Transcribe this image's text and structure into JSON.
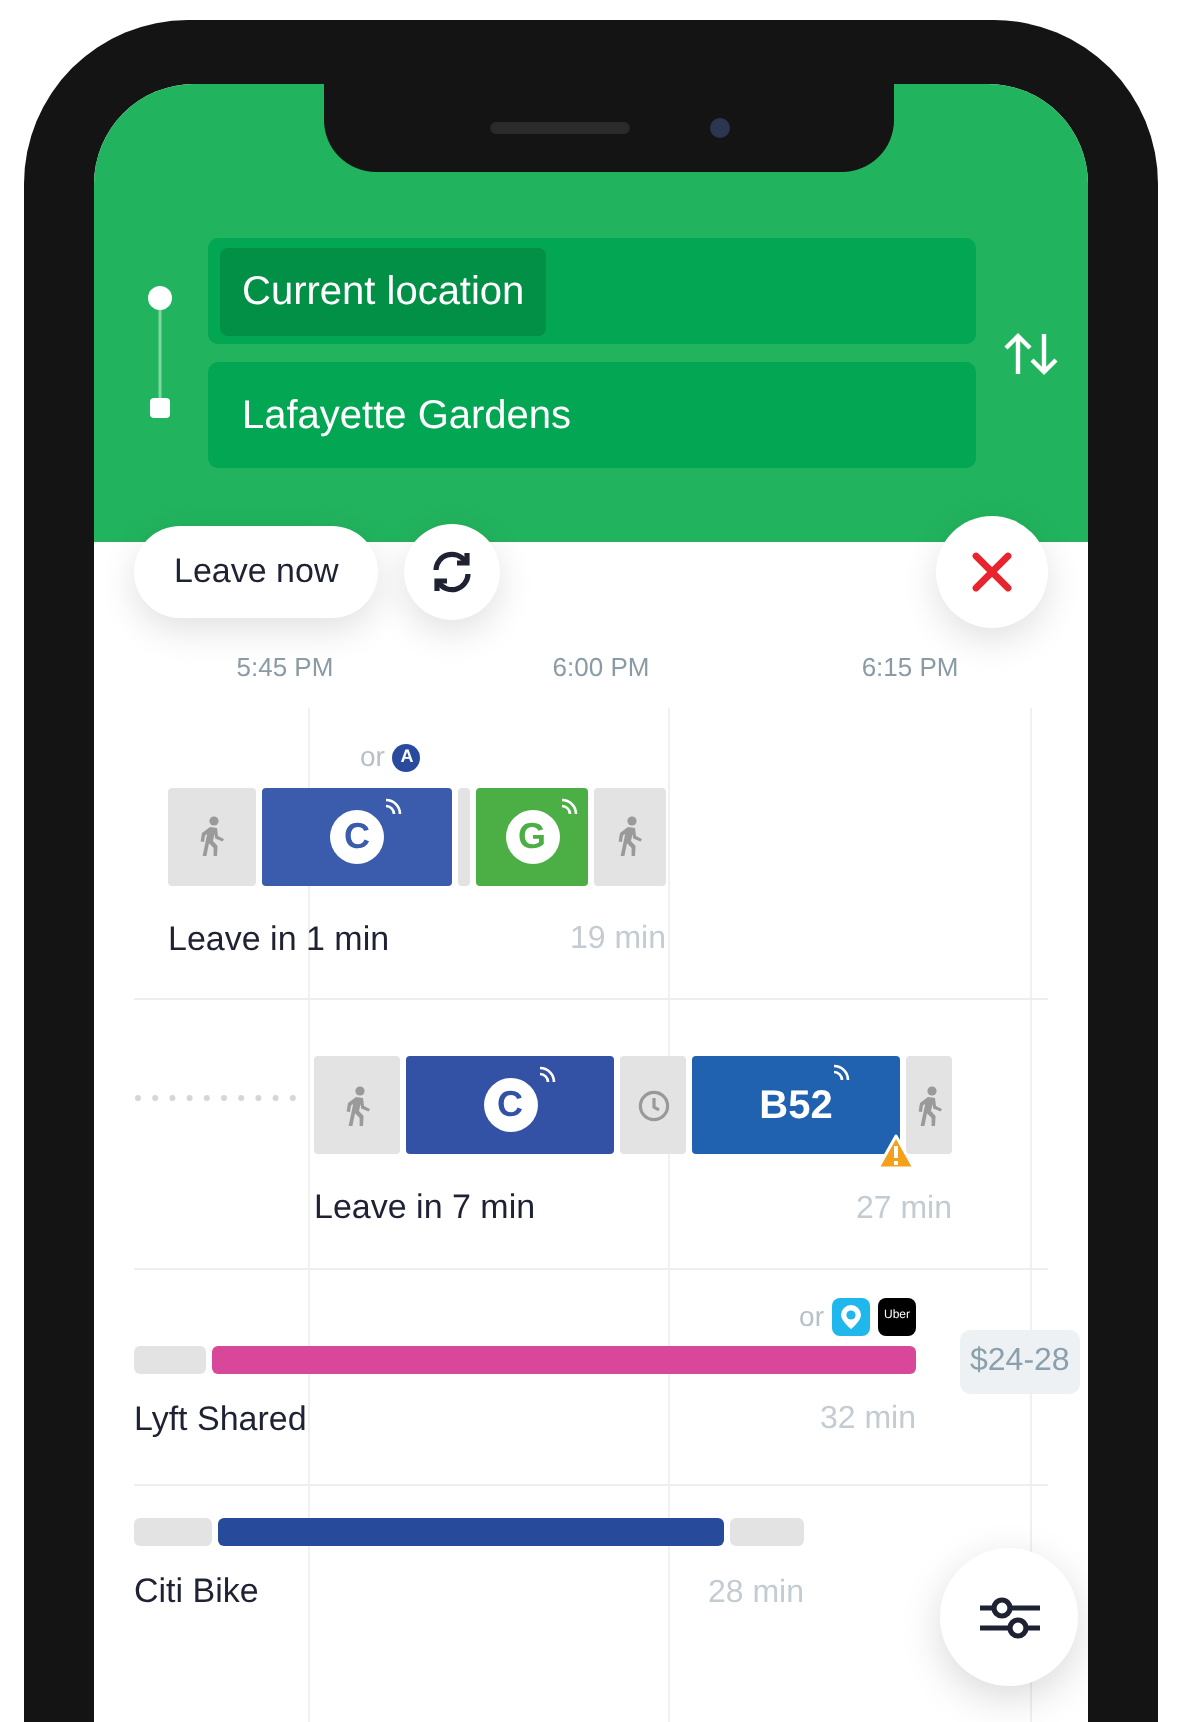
{
  "origin": {
    "value": "Current location"
  },
  "destination": {
    "value": "Lafayette Gardens"
  },
  "time_button": {
    "label": "Leave now"
  },
  "timeline": {
    "ticks": [
      "5:45 PM",
      "6:00 PM",
      "6:15 PM"
    ]
  },
  "routes": [
    {
      "kind": "transit",
      "alternative": {
        "prefix": "or",
        "line": "A",
        "color": "#2a4a9e"
      },
      "segments": [
        {
          "kind": "walk"
        },
        {
          "kind": "line",
          "label": "C",
          "color": "#3b5cac",
          "realtime": true
        },
        {
          "kind": "transfer"
        },
        {
          "kind": "line",
          "label": "G",
          "color": "#4caf45",
          "realtime": true
        },
        {
          "kind": "walk"
        }
      ],
      "departure": "Leave in 1 min",
      "duration": "19 min"
    },
    {
      "kind": "transit",
      "delayed_start": true,
      "segments": [
        {
          "kind": "walk"
        },
        {
          "kind": "line",
          "label": "C",
          "color": "#3352a6",
          "realtime": true
        },
        {
          "kind": "wait"
        },
        {
          "kind": "bus",
          "label": "B52",
          "color": "#2162b0",
          "realtime": true,
          "warning": true
        },
        {
          "kind": "walk"
        }
      ],
      "departure": "Leave in 7 min",
      "duration": "27 min"
    },
    {
      "kind": "ride",
      "alternative": {
        "prefix": "or",
        "apps": [
          "Uber"
        ]
      },
      "segments": [
        {
          "kind": "access"
        },
        {
          "kind": "ride",
          "color": "#d9479a"
        }
      ],
      "price": "$24-28",
      "departure": "Lyft Shared",
      "duration": "32 min"
    },
    {
      "kind": "ride",
      "segments": [
        {
          "kind": "access"
        },
        {
          "kind": "ride",
          "color": "#274a9a"
        },
        {
          "kind": "access"
        }
      ],
      "departure": "Citi Bike",
      "duration": "28 min"
    }
  ]
}
